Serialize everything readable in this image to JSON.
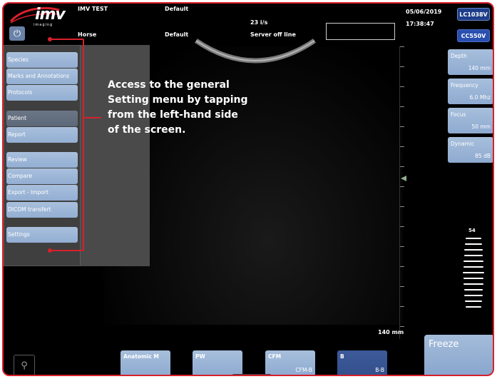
{
  "topbar": {
    "logo_text": "imv",
    "logo_sub": "imaging",
    "patient_name": "IMV TEST",
    "species": "Horse",
    "preset_top": "Default",
    "preset_bottom": "Default",
    "frame_rate": "23 i/s",
    "server_status": "Server off line",
    "date": "05/06/2019",
    "time": "17:38:47",
    "probe_1": "LC1038V",
    "probe_2": "CC550V"
  },
  "menu": {
    "items": [
      {
        "label": "Species",
        "selected": false
      },
      {
        "label": "Marks and Annotations",
        "selected": false
      },
      {
        "label": "Protocols",
        "selected": false
      },
      {
        "label": "Patient",
        "selected": true
      },
      {
        "label": "Report",
        "selected": false
      },
      {
        "label": "Review",
        "selected": false
      },
      {
        "label": "Compare",
        "selected": false
      },
      {
        "label": "Export - Import",
        "selected": false
      },
      {
        "label": "DICOM transfert",
        "selected": false
      },
      {
        "label": "Settings",
        "selected": false
      }
    ]
  },
  "callout": "Access to the general Setting menu by tapping from the left-hand side of the screen.",
  "params": [
    {
      "label": "Depth",
      "value": "140 mm"
    },
    {
      "label": "Frequency",
      "value": "6.0 Mhz"
    },
    {
      "label": "Focus",
      "value": "50 mm"
    },
    {
      "label": "Dynamic",
      "value": "85 dB"
    }
  ],
  "depth_readout": "140 mm",
  "gain_value": "54",
  "freeze_label": "Freeze",
  "modes": [
    {
      "label": "Anatomic M",
      "sub": ""
    },
    {
      "label": "PW",
      "sub": ""
    },
    {
      "label": "CFM",
      "sub": "CFM-B"
    },
    {
      "label": "B",
      "sub": "B-B"
    }
  ],
  "icons": {
    "power": "power-icon",
    "probe": "probe-icon",
    "chevron": "chevron-up-icon"
  },
  "colors": {
    "frame_border": "#d8202b",
    "button_blue": "#9bb6d8",
    "probe_active": "#2a4fb0"
  }
}
